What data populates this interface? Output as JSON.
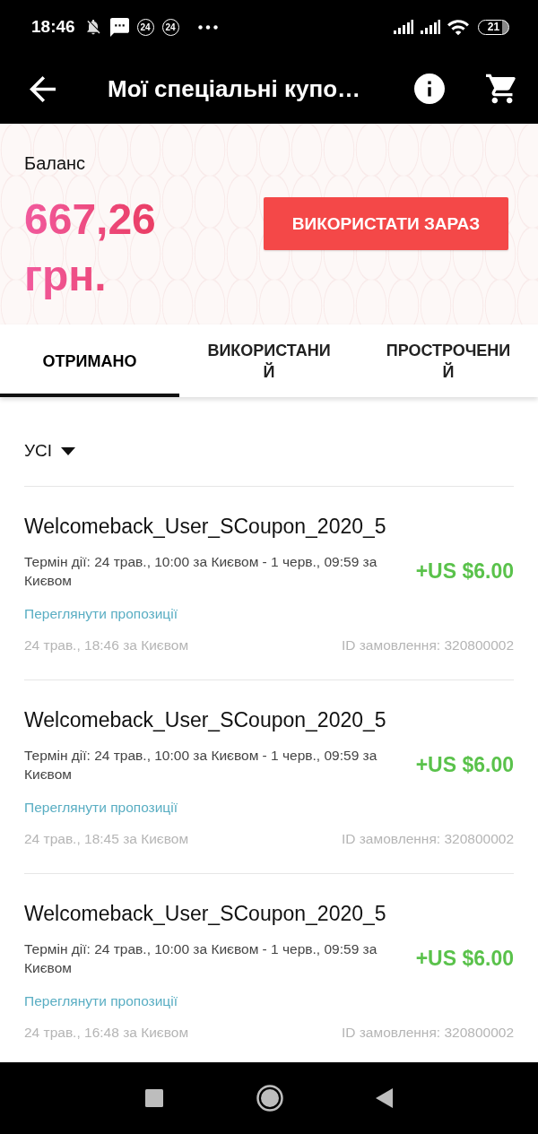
{
  "status_bar": {
    "time": "18:46",
    "notification_badges": [
      "24",
      "24"
    ],
    "battery": "21"
  },
  "app_bar": {
    "title": "Мої спеціальні купо…"
  },
  "balance": {
    "label": "Баланс",
    "amount": "667,26 грн.",
    "button": "ВИКОРИСТАТИ ЗАРАЗ"
  },
  "tabs": [
    {
      "label": "ОТРИМАНО",
      "selected": true
    },
    {
      "label": "ВИКОРИСТАНИЙ",
      "selected": false
    },
    {
      "label": "ПРОСТРОЧЕНИЙ",
      "selected": false
    }
  ],
  "filter": {
    "label": "УСІ"
  },
  "coupons": [
    {
      "name": "Welcomeback_User_SCoupon_2020_5",
      "validity": "Термін дії: 24 трав., 10:00 за Києвом - 1 черв., 09:59 за Києвом",
      "amount": "+US $6.00",
      "link": "Переглянути пропозиції",
      "received": "24 трав., 18:46 за Києвом",
      "order_id": "ID замовлення: 320800002"
    },
    {
      "name": "Welcomeback_User_SCoupon_2020_5",
      "validity": "Термін дії: 24 трав., 10:00 за Києвом - 1 черв., 09:59 за Києвом",
      "amount": "+US $6.00",
      "link": "Переглянути пропозиції",
      "received": "24 трав., 18:45 за Києвом",
      "order_id": "ID замовлення: 320800002"
    },
    {
      "name": "Welcomeback_User_SCoupon_2020_5",
      "validity": "Термін дії: 24 трав., 10:00 за Києвом - 1 черв., 09:59 за Києвом",
      "amount": "+US $6.00",
      "link": "Переглянути пропозиції",
      "received": "24 трав., 16:48 за Києвом",
      "order_id": "ID замовлення: 320800002"
    }
  ]
}
